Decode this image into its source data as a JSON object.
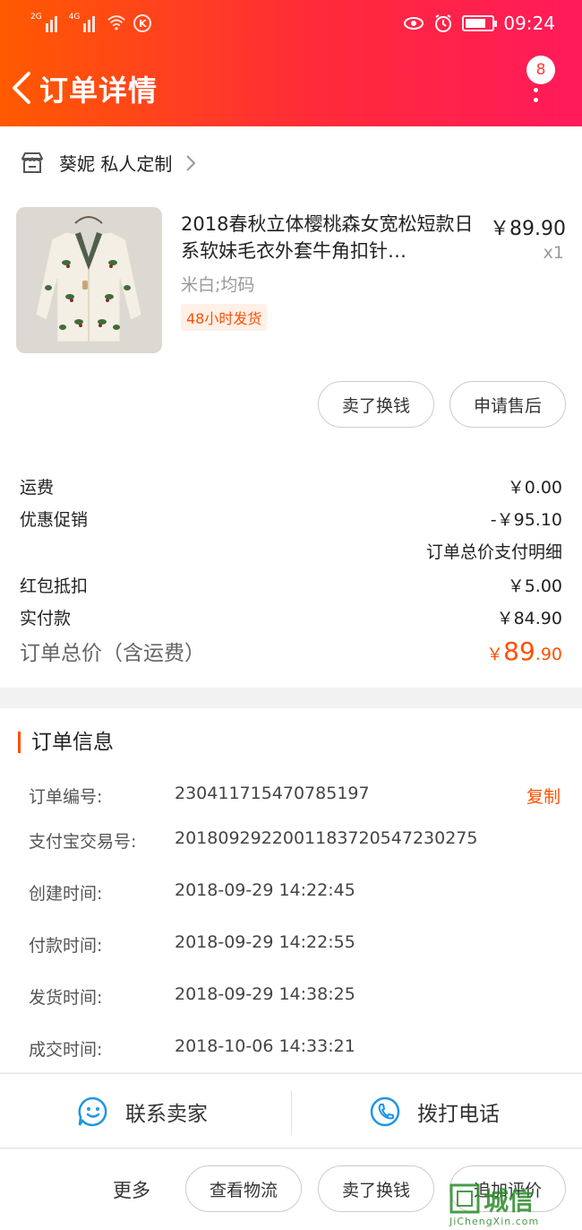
{
  "status_bar": {
    "network1": "2G",
    "network2": "4G",
    "time": "09:24"
  },
  "header": {
    "title": "订单详情",
    "more_badge": "8"
  },
  "shop": {
    "name": "葵妮 私人定制"
  },
  "item": {
    "title": "2018春秋立体樱桃森女宽松短款日系软妹毛衣外套牛角扣针…",
    "price": "￥89.90",
    "quantity": "x1",
    "spec": "米白;均码",
    "shipping_badge": "48小时发货"
  },
  "item_actions": {
    "sell_button": "卖了换钱",
    "after_sale_button": "申请售后"
  },
  "fees": {
    "shipping_label": "运费",
    "shipping_value": "￥0.00",
    "promo_label": "优惠促销",
    "promo_value": "-￥95.10",
    "detail_link": "订单总价支付明细",
    "redpacket_label": "红包抵扣",
    "redpacket_value": "￥5.00",
    "paid_label": "实付款",
    "paid_value": "￥84.90",
    "total_label": "订单总价（含运费）",
    "total_currency": "￥",
    "total_int": "89",
    "total_dec": ".90"
  },
  "order_info": {
    "title": "订单信息",
    "copy_label": "复制",
    "rows": [
      {
        "label": "订单编号:",
        "value": "230411715470785197"
      },
      {
        "label": "支付宝交易号:",
        "value": "2018092922001183720547230275"
      },
      {
        "label": "创建时间:",
        "value": "2018-09-29 14:22:45"
      },
      {
        "label": "付款时间:",
        "value": "2018-09-29 14:22:55"
      },
      {
        "label": "发货时间:",
        "value": "2018-09-29 14:38:25"
      },
      {
        "label": "成交时间:",
        "value": "2018-10-06 14:33:21"
      }
    ]
  },
  "contact": {
    "seller": "联系卖家",
    "phone": "拨打电话"
  },
  "bottom_actions": {
    "more": "更多",
    "logistics": "查看物流",
    "sell": "卖了换钱",
    "add_review": "追加评价"
  },
  "watermark": {
    "text": "城信",
    "sub": "JiChengXin.com"
  },
  "colors": {
    "accent": "#ff5000",
    "header_start": "#ff5a00",
    "header_end": "#ff1a5a"
  }
}
